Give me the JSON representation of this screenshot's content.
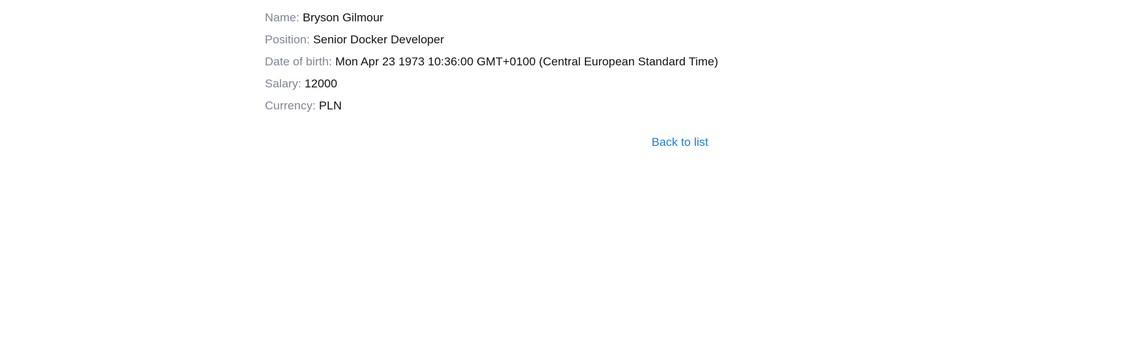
{
  "employee": {
    "name_label": "Name:",
    "name": "Bryson Gilmour",
    "position_label": "Position:",
    "position": "Senior Docker Developer",
    "dob_label": "Date of birth:",
    "dob": "Mon Apr 23 1973 10:36:00 GMT+0100 (Central European Standard Time)",
    "salary_label": "Salary:",
    "salary": "12000",
    "currency_label": "Currency:",
    "currency": "PLN"
  },
  "actions": {
    "back_label": "Back to list"
  },
  "colors": {
    "label": "#7e8595",
    "value": "#111111",
    "link": "#1a7fe0"
  }
}
